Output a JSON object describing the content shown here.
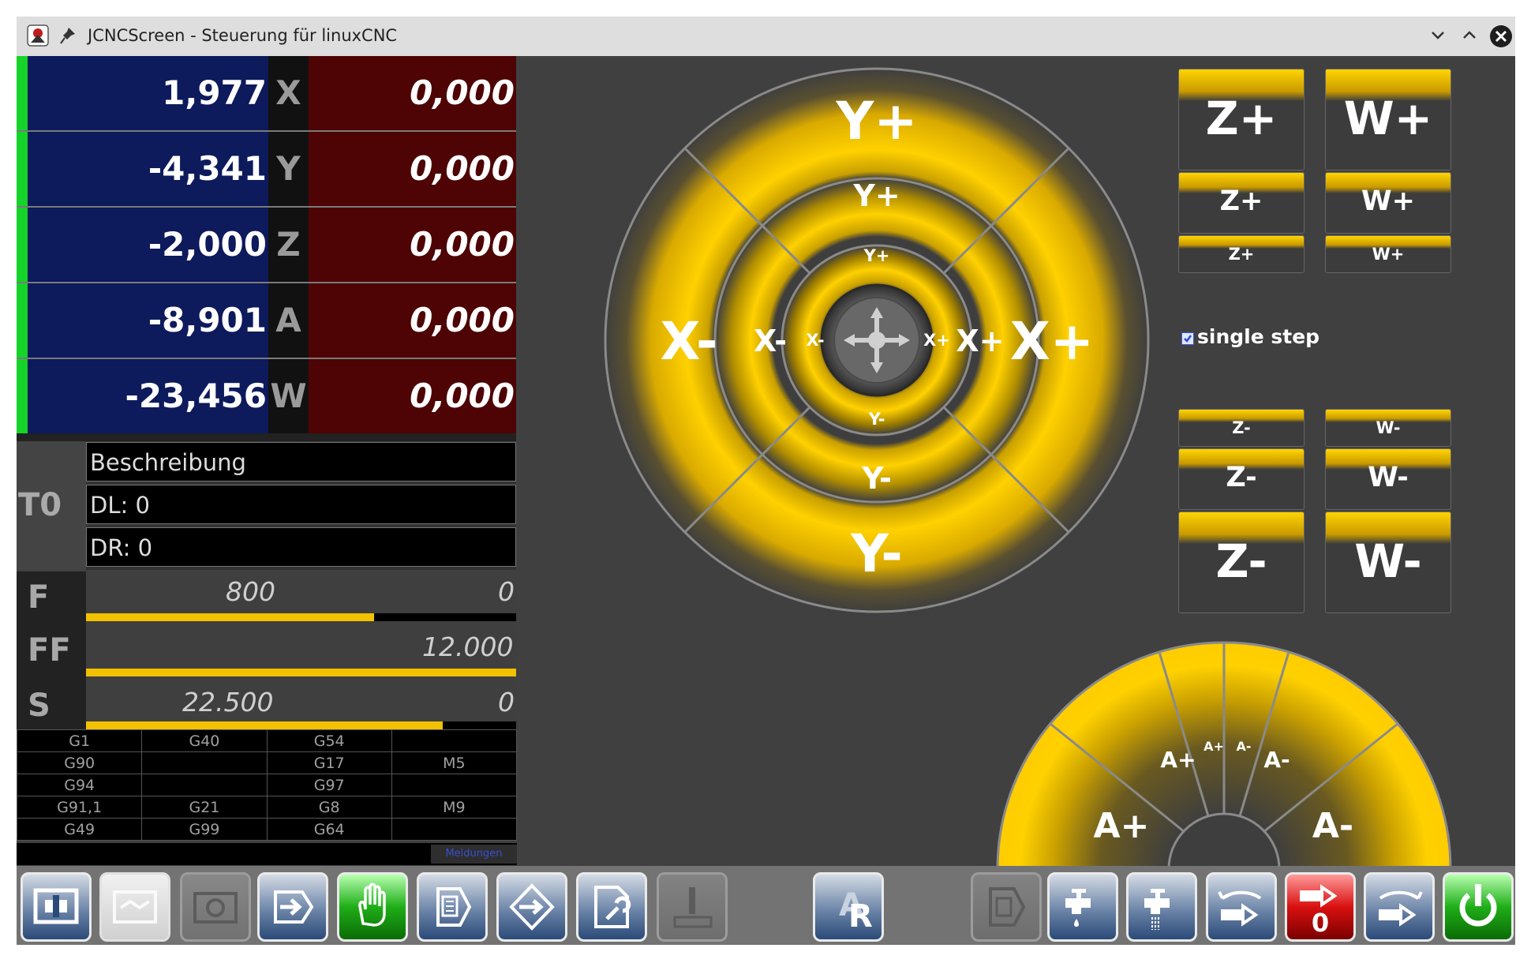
{
  "window": {
    "title": "JCNCScreen - Steuerung für linuxCNC",
    "controls": [
      "minimize",
      "maximize",
      "close"
    ]
  },
  "dro": [
    {
      "value": "1,977",
      "axis": "X",
      "dtg": "0,000"
    },
    {
      "value": "-4,341",
      "axis": "Y",
      "dtg": "0,000"
    },
    {
      "value": "-2,000",
      "axis": "Z",
      "dtg": "0,000"
    },
    {
      "value": "-8,901",
      "axis": "A",
      "dtg": "0,000"
    },
    {
      "value": "-23,456",
      "axis": "W",
      "dtg": "0,000"
    }
  ],
  "tool": {
    "number": "T0",
    "description": "Beschreibung",
    "dl": "DL: 0",
    "dr": "DR: 0"
  },
  "feeds": {
    "f": {
      "label": "F",
      "value": "800",
      "override": "0",
      "level": 0.67
    },
    "ff": {
      "label": "FF",
      "value": "12.000",
      "level": 1.0
    },
    "s": {
      "label": "S",
      "value": "22.500",
      "override": "0",
      "level": 0.83
    }
  },
  "gcodes": [
    [
      "G1",
      "G40",
      "G54",
      ""
    ],
    [
      "G90",
      "",
      "G17",
      "M5"
    ],
    [
      "G94",
      "",
      "G97",
      ""
    ],
    [
      "G91,1",
      "G21",
      "G8",
      "M9"
    ],
    [
      "G49",
      "G99",
      "G64",
      ""
    ]
  ],
  "messages_label": "Meldungen",
  "jog_xy": {
    "y_plus": [
      "Y+",
      "Y+",
      "Y+"
    ],
    "y_minus": [
      "Y-",
      "Y-",
      "Y-"
    ],
    "x_plus": [
      "X+",
      "X+",
      "X+"
    ],
    "x_minus": [
      "X-",
      "X-",
      "X-"
    ],
    "accent": "#ffc800"
  },
  "jog_z": {
    "plus": [
      "Z+",
      "Z+",
      "Z+"
    ],
    "minus": [
      "Z-",
      "Z-",
      "Z-"
    ]
  },
  "jog_w": {
    "plus": [
      "W+",
      "W+",
      "W+"
    ],
    "minus": [
      "W-",
      "W-",
      "W-"
    ]
  },
  "single_step": {
    "label": "single step",
    "checked": true
  },
  "jog_a": {
    "plus": [
      "A+",
      "A+",
      "A+"
    ],
    "minus": [
      "A-",
      "A-",
      "A-"
    ]
  },
  "toolbar": [
    {
      "icon": "auto-mode-icon",
      "style": "normal"
    },
    {
      "icon": "mdi-mode-icon",
      "style": "disabled-light"
    },
    {
      "icon": "camera-icon",
      "style": "disabled"
    },
    {
      "icon": "step-into-icon",
      "style": "normal"
    },
    {
      "icon": "manual-hand-icon",
      "style": "green"
    },
    {
      "icon": "file-open-icon",
      "style": "normal"
    },
    {
      "icon": "home-icon",
      "style": "normal"
    },
    {
      "icon": "tool-edit-icon",
      "style": "normal"
    },
    {
      "icon": "probe-icon",
      "style": "disabled"
    },
    {
      "icon": "reset-r-icon",
      "style": "normal"
    },
    {
      "icon": "document-arrow-icon",
      "style": "disabled"
    },
    {
      "icon": "coolant-mist-icon",
      "style": "normal"
    },
    {
      "icon": "coolant-flood-icon",
      "style": "normal"
    },
    {
      "icon": "spindle-ccw-icon",
      "style": "normal"
    },
    {
      "icon": "spindle-stop-icon",
      "style": "red",
      "text": "0"
    },
    {
      "icon": "spindle-cw-icon",
      "style": "normal"
    },
    {
      "icon": "power-icon",
      "style": "green"
    }
  ]
}
